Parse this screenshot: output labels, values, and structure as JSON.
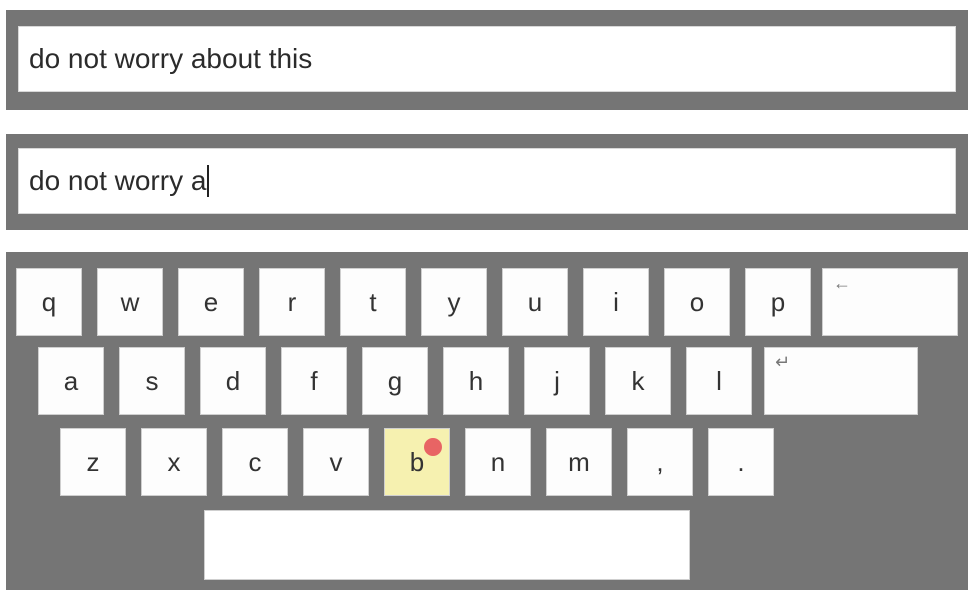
{
  "target_text": "do not worry about this",
  "typed_text": "do not worry a",
  "keyboard": {
    "row1": [
      "q",
      "w",
      "e",
      "r",
      "t",
      "y",
      "u",
      "i",
      "o",
      "p"
    ],
    "row1_action": "←",
    "row2": [
      "a",
      "s",
      "d",
      "f",
      "g",
      "h",
      "j",
      "k",
      "l"
    ],
    "row2_action": "↵",
    "row3": [
      "z",
      "x",
      "c",
      "v",
      "b",
      "n",
      "m",
      ",",
      "."
    ],
    "highlighted_key": "b"
  },
  "colors": {
    "panel": "#757575",
    "highlight": "#f6f1b0",
    "touch_dot": "#e86464"
  }
}
